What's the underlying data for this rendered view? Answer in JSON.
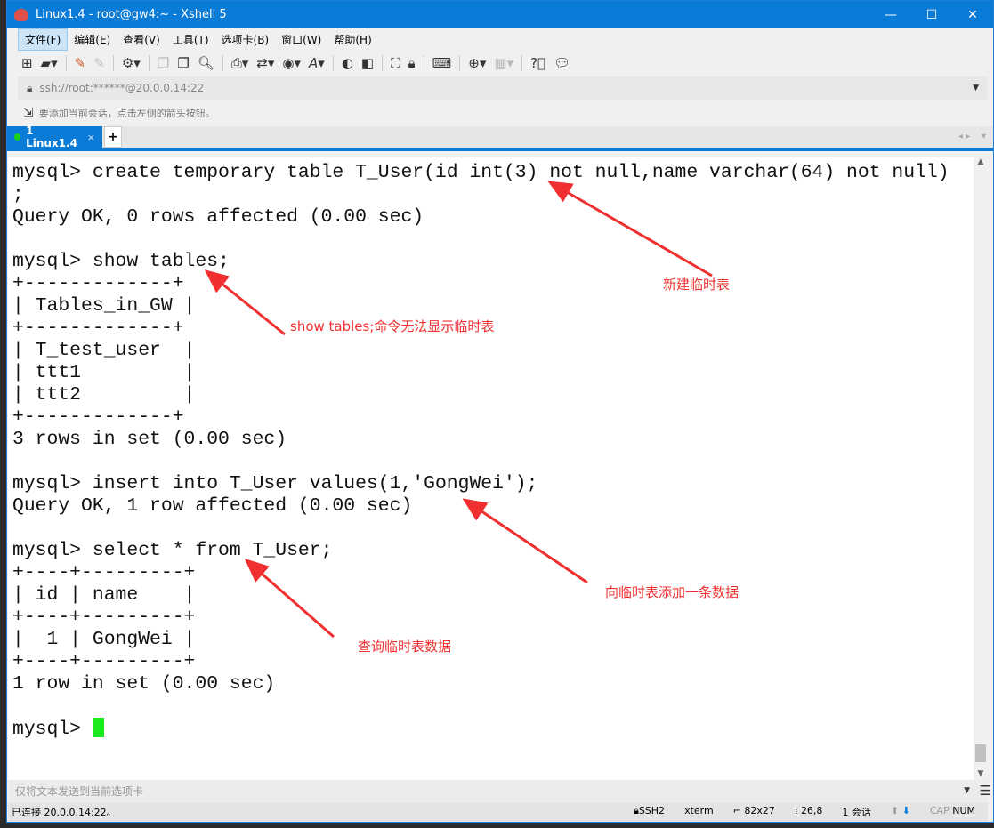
{
  "window": {
    "title": "Linux1.4 - root@gw4:~ - Xshell 5",
    "controls": [
      "—",
      "☐",
      "✕"
    ]
  },
  "menu": [
    "文件(F)",
    "编辑(E)",
    "查看(V)",
    "工具(T)",
    "选项卡(B)",
    "窗口(W)",
    "帮助(H)"
  ],
  "address": {
    "value": "ssh://root:******@20.0.0.14:22"
  },
  "hint": "要添加当前会话，点击左侧的箭头按钮。",
  "tabs": [
    {
      "label": "1 Linux1.4",
      "status_color": "#1ad01a"
    }
  ],
  "terminal": {
    "lines": [
      "mysql> create temporary table T_User(id int(3) not null,name varchar(64) not null)",
      ";",
      "Query OK, 0 rows affected (0.00 sec)",
      "",
      "mysql> show tables;",
      "+-------------+",
      "| Tables_in_GW |",
      "+-------------+",
      "| T_test_user  |",
      "| ttt1         |",
      "| ttt2         |",
      "+-------------+",
      "3 rows in set (0.00 sec)",
      "",
      "mysql> insert into T_User values(1,'GongWei');",
      "Query OK, 1 row affected (0.00 sec)",
      "",
      "mysql> select * from T_User;",
      "+----+---------+",
      "| id | name    |",
      "+----+---------+",
      "|  1 | GongWei |",
      "+----+---------+",
      "1 row in set (0.00 sec)",
      "",
      "mysql> "
    ],
    "cursor_color": "#1ee81e"
  },
  "annotations": [
    "新建临时表",
    "show tables;命令无法显示临时表",
    "向临时表添加一条数据",
    "查询临时表数据"
  ],
  "annotation_color": "#f03030",
  "send_bar": {
    "placeholder": "仅将文本发送到当前选项卡"
  },
  "status": {
    "connected": "已连接 20.0.0.14:22。",
    "protocol": "SSH2",
    "term": "xterm",
    "size": "82x27",
    "cursor_pos": "26,8",
    "sessions": "1 会话",
    "cap": "CAP",
    "num": "NUM"
  }
}
